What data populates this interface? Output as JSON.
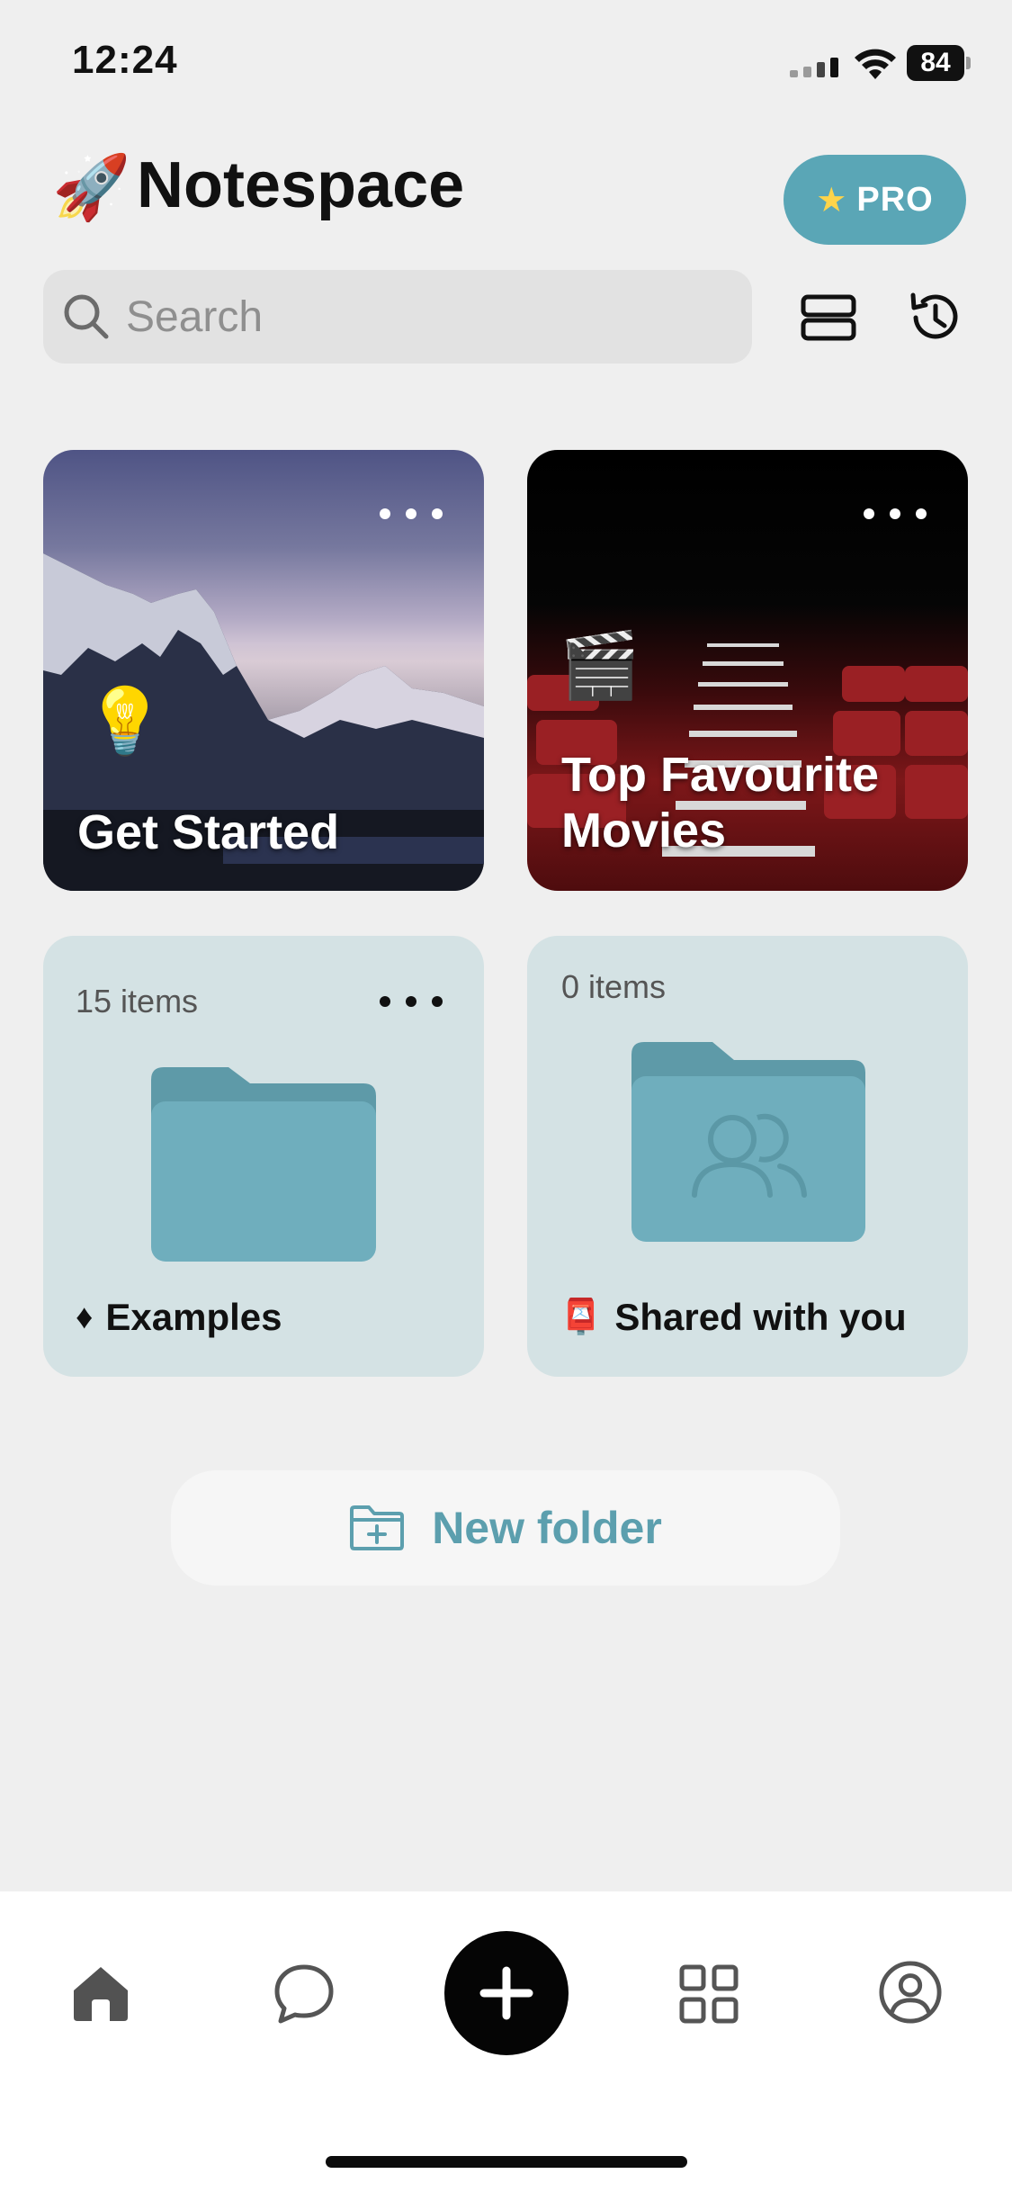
{
  "status_bar": {
    "time": "12:24",
    "battery_level": "84"
  },
  "header": {
    "app_icon": "🚀",
    "title": "Notespace",
    "pro_label": "PRO",
    "pro_icon": "star-icon"
  },
  "search": {
    "placeholder": "Search",
    "value": ""
  },
  "toolbar": {
    "layout_icon": "list-layout-icon",
    "history_icon": "history-icon"
  },
  "cards": [
    {
      "title": "Get Started",
      "emoji": "💡"
    },
    {
      "title": "Top Favourite Movies",
      "emoji": "🎬"
    }
  ],
  "folders": [
    {
      "count": "15 items",
      "name": "Examples",
      "icon": "♦"
    },
    {
      "count": "0 items",
      "name": "Shared with you",
      "icon": "📮"
    }
  ],
  "new_folder": {
    "label": "New folder"
  },
  "tabbar": {
    "items": [
      "home-icon",
      "chat-icon",
      "add-icon",
      "grid-icon",
      "profile-icon"
    ]
  },
  "colors": {
    "accent": "#5aa6b6",
    "folder_bg": "#d4e2e4",
    "folder_fill": "#6faebd"
  }
}
